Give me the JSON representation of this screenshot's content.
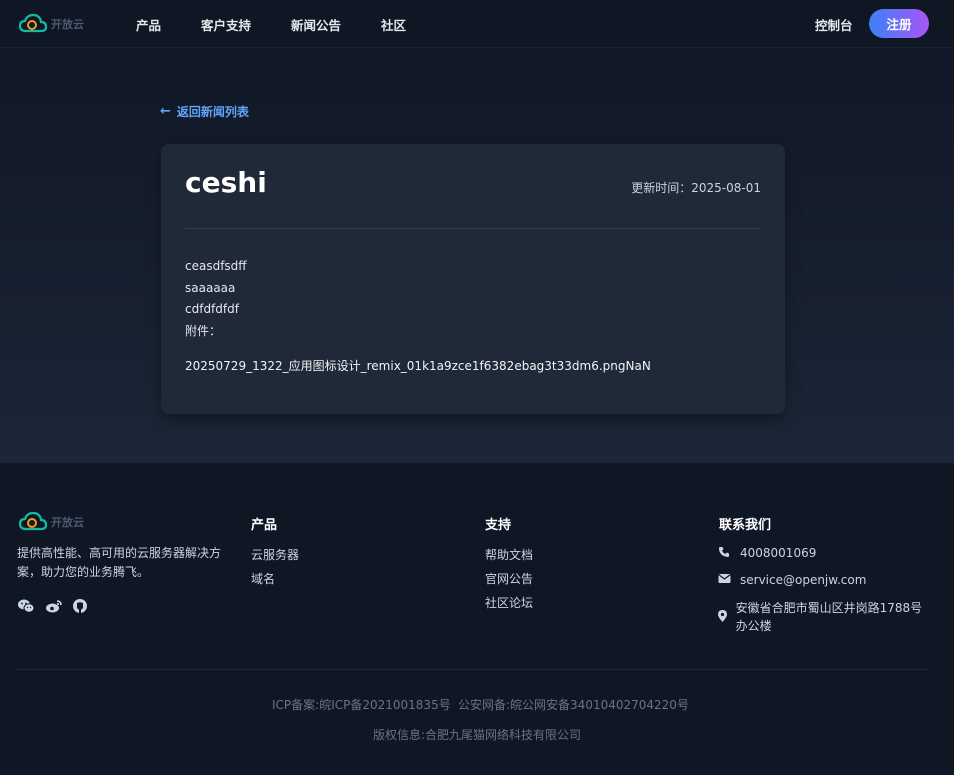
{
  "header": {
    "logo_text": "开放云",
    "nav": [
      "产品",
      "客户支持",
      "新闻公告",
      "社区"
    ],
    "console": "控制台",
    "register": "注册"
  },
  "main": {
    "back_link": "返回新闻列表",
    "title": "ceshi",
    "update_time": "更新时间：2025-08-01",
    "content_lines": [
      "ceasdfsdff",
      "saaaaaa",
      "cdfdfdfdf",
      "附件："
    ],
    "attachment": "20250729_1322_应用图标设计_remix_01k1a9zce1f6382ebag3t33dm6.pngNaN"
  },
  "footer": {
    "logo_text": "开放云",
    "description": "提供高性能、高可用的云服务器解决方案，助力您的业务腾飞。",
    "products_title": "产品",
    "products": [
      "云服务器",
      "域名"
    ],
    "support_title": "支持",
    "support": [
      "帮助文档",
      "官网公告",
      "社区论坛"
    ],
    "contact_title": "联系我们",
    "phone": "4008001069",
    "email": "service@openjw.com",
    "address": "安徽省合肥市蜀山区井岗路1788号办公楼",
    "icp": "ICP备案:皖ICP备2021001835号",
    "police": "公安网备:皖公网安备34010402704220号",
    "copyright": "版权信息:合肥九尾猫网络科技有限公司"
  },
  "colors": {
    "accent": "#60a5fa",
    "button_gradient_start": "#3b82f6",
    "button_gradient_end": "#a855f7",
    "background": "#111827",
    "card": "#1f2937"
  },
  "icons": [
    "cloud-logo-icon",
    "arrow-left-icon",
    "wechat-icon",
    "weibo-icon",
    "github-icon",
    "phone-icon",
    "envelope-icon",
    "map-pin-icon"
  ]
}
